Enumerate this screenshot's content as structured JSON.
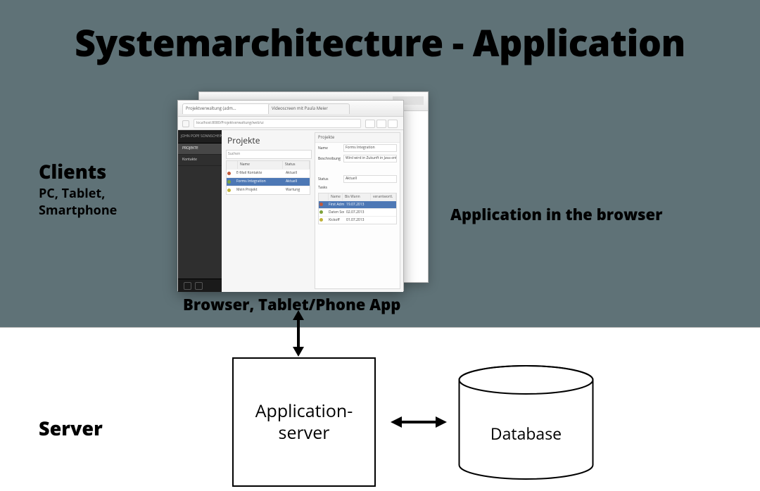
{
  "title": "Systemarchitecture - Application",
  "clients": {
    "heading": "Clients",
    "sub": "PC, Tablet,\nSmartphone"
  },
  "app_in_browser": "Application in the browser",
  "browser_caption": "Browser, Tablet/Phone App",
  "server_heading": "Server",
  "appserver_label": "Application-\nserver",
  "database_label": "Database",
  "mock": {
    "tab1": "Projektverwaltung (adm...",
    "tab2": "Videoscreen mit Paula Meier",
    "url": "localhost:8080/Projektverwaltung/web/ui",
    "sidebar_top": "JOHN POPE SONNSCHEIN",
    "sidebar_item_projects": "PROJEKTE",
    "sidebar_item_contacts": "Kontakte",
    "page_title": "Projekte",
    "search_label": "Suchen",
    "grid": {
      "col_name": "Name",
      "col_status": "Status",
      "rows": [
        {
          "bullet": "#c35a3a",
          "name": "E-Mail Kontakte",
          "status": "Aktuell"
        },
        {
          "bullet": "#7fa33c",
          "name": "Forms Integration",
          "status": "Aktuell",
          "selected": true
        },
        {
          "bullet": "#c0b23a",
          "name": "Mein Projekt",
          "status": "Wartung"
        }
      ]
    },
    "panel": {
      "title": "Projekte",
      "name_label": "Name",
      "name_value": "Forms Integration",
      "desc_label": "Beschreibung",
      "desc_value": "Wird wird in Zukunft in Java entwickelt",
      "status_label": "Status",
      "status_value": "Aktuell",
      "tasks_label": "Tasks",
      "tasks": {
        "col_name": "Name",
        "col_due": "Bis Wann",
        "col_check": "verantwortl.",
        "rows": [
          {
            "bullet": "#c35a3a",
            "name": "First Admin View",
            "due": "19.07.2013",
            "selected": true
          },
          {
            "bullet": "#7fa33c",
            "name": "Daten Sources",
            "due": "02.07.2013"
          },
          {
            "bullet": "#c0b23a",
            "name": "Kickoff",
            "due": "01.07.2013"
          }
        ]
      }
    }
  }
}
